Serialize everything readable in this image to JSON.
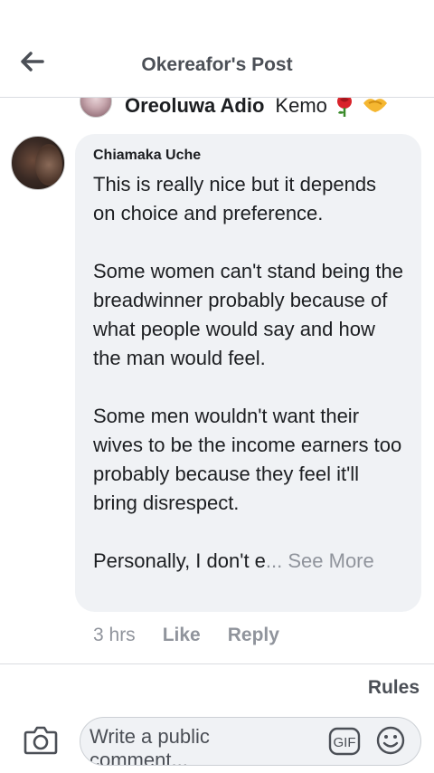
{
  "header": {
    "title": "Okereafor's Post",
    "back_icon": "back-arrow-icon"
  },
  "previous_reply": {
    "name": "Oreoluwa Adio",
    "text": "Kemo",
    "emojis": [
      "rose-icon",
      "handshake-icon"
    ]
  },
  "comment": {
    "author": "Chiamaka Uche",
    "paragraphs": [
      "This is really nice but it depends on choice and preference.",
      "Some women can't stand being the breadwinner probably because of what people would say and how the man would feel.",
      "Some men wouldn't want their wives to be the income earners too probably because they feel it'll bring disrespect."
    ],
    "truncated_line": "Personally, I don't e",
    "see_more_label": "... See More",
    "time": "3 hrs",
    "like_label": "Like",
    "reply_label": "Reply"
  },
  "footer": {
    "rules_label": "Rules",
    "composer_placeholder": "Write a public comment...",
    "gif_label": "GIF",
    "icons": [
      "camera-icon",
      "gif-icon",
      "emoji-icon"
    ]
  }
}
